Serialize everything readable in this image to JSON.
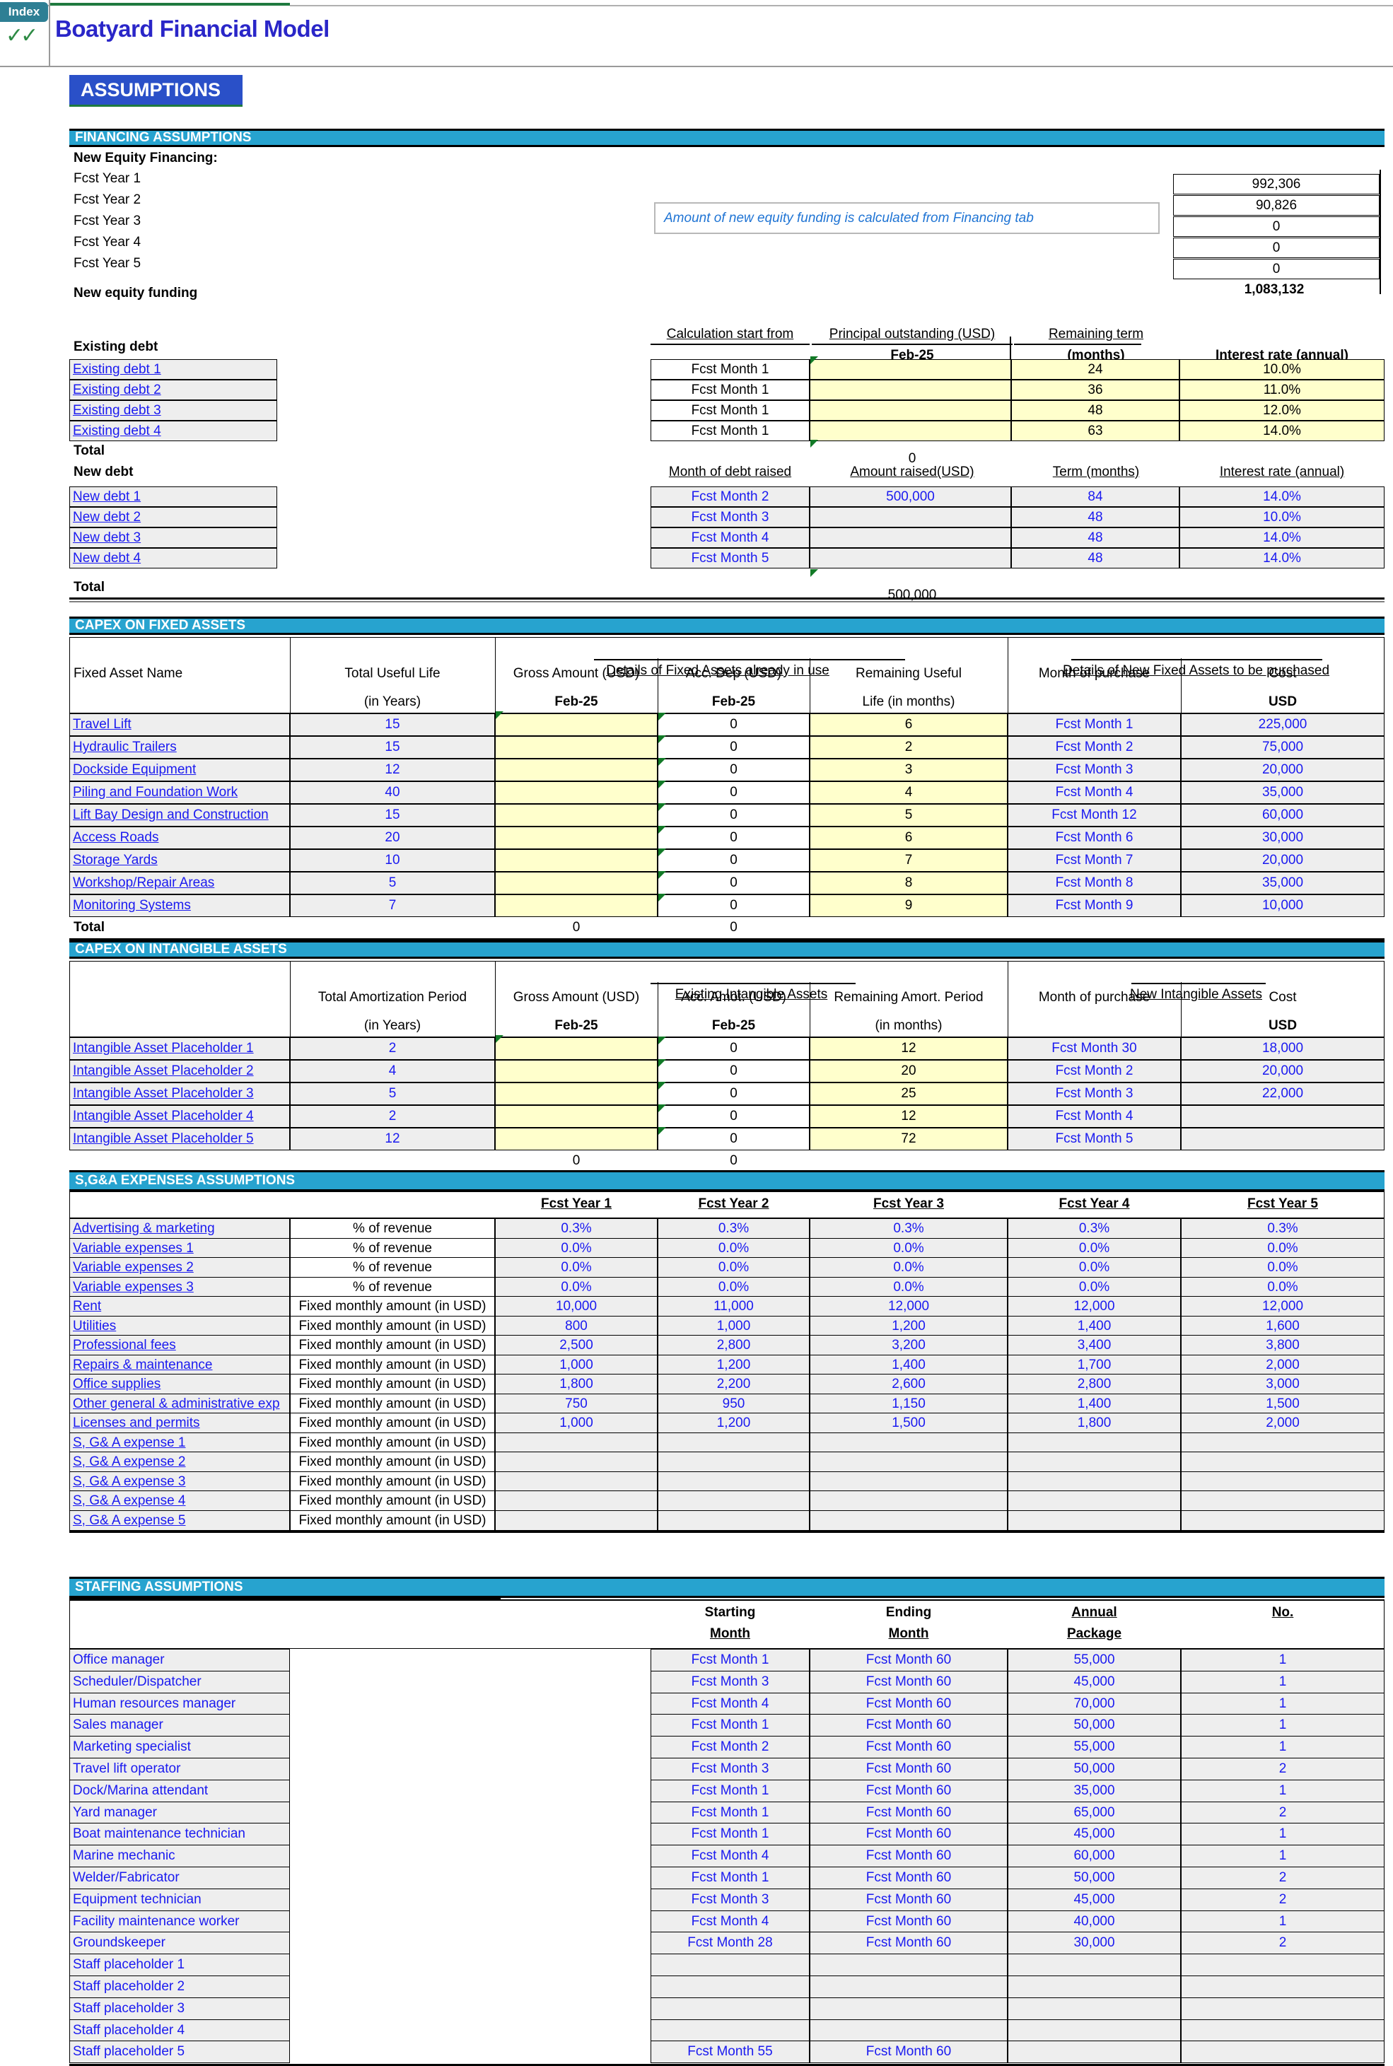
{
  "app": {
    "index_tab": "Index",
    "checks": "✓✓",
    "title": "Boatyard Financial Model",
    "page_banner": "ASSUMPTIONS"
  },
  "financing": {
    "banner": "FINANCING ASSUMPTIONS",
    "equity_heading": "New Equity Financing:",
    "equity_rows": [
      {
        "label": "Fcst Year 1",
        "value": "992,306"
      },
      {
        "label": "Fcst Year 2",
        "value": "90,826"
      },
      {
        "label": "Fcst Year 3",
        "value": "0"
      },
      {
        "label": "Fcst Year 4",
        "value": "0"
      },
      {
        "label": "Fcst Year 5",
        "value": "0"
      }
    ],
    "total_label": "New equity funding",
    "total_value": "1,083,132",
    "note": "Amount of new equity funding is calculated from Financing  tab",
    "existing_debt": {
      "section_label": "Existing debt",
      "headers_top": [
        "Calculation start from",
        "Principal outstanding (USD)",
        "Remaining term",
        ""
      ],
      "headers_bottom": [
        "",
        "Feb-25",
        "(months)",
        "Interest rate (annual)"
      ],
      "rows": [
        {
          "name": "Existing debt 1",
          "start": "Fcst Month 1",
          "principal": "",
          "term": "24",
          "rate": "10.0%"
        },
        {
          "name": "Existing debt 2",
          "start": "Fcst Month 1",
          "principal": "",
          "term": "36",
          "rate": "11.0%"
        },
        {
          "name": "Existing debt 3",
          "start": "Fcst Month 1",
          "principal": "",
          "term": "48",
          "rate": "12.0%"
        },
        {
          "name": "Existing debt 4",
          "start": "Fcst Month 1",
          "principal": "",
          "term": "63",
          "rate": "14.0%"
        }
      ],
      "total_label": "Total",
      "total_value": "0"
    },
    "new_debt": {
      "section_label": "New debt",
      "headers": [
        "Month of debt raised",
        "Amount raised(USD)",
        "Term (months)",
        "Interest rate (annual)"
      ],
      "rows": [
        {
          "name": "New debt 1",
          "month": "Fcst Month 2",
          "amount": "500,000",
          "term": "84",
          "rate": "14.0%"
        },
        {
          "name": "New debt 2",
          "month": "Fcst Month 3",
          "amount": "",
          "term": "48",
          "rate": "10.0%"
        },
        {
          "name": "New debt 3",
          "month": "Fcst Month 4",
          "amount": "",
          "term": "48",
          "rate": "14.0%"
        },
        {
          "name": "New debt 4",
          "month": "Fcst Month 5",
          "amount": "",
          "term": "48",
          "rate": "14.0%"
        }
      ],
      "total_label": "Total",
      "total_value": "500,000"
    }
  },
  "capex_fixed": {
    "banner": "CAPEX ON FIXED ASSETS",
    "group_existing": "Details of Fixed Assets already in use",
    "group_new": "Details of New Fixed Assets to be purchased",
    "headers": {
      "name": "Fixed Asset Name",
      "life1": "Total Useful Life",
      "life2": "(in Years)",
      "gross1": "Gross Amount (USD)",
      "gross2": "Feb-25",
      "accdep1": "Acc. Dep (USD)",
      "accdep2": "Feb-25",
      "remaining1": "Remaining Useful",
      "remaining2": "Life (in months)",
      "month": "Month of purchase",
      "cost1": "Cost",
      "cost2": "USD"
    },
    "rows": [
      {
        "name": "Travel Lift",
        "life": "15",
        "gross": "",
        "accdep": "0",
        "remaining": "6",
        "month": "Fcst Month 1",
        "cost": "225,000"
      },
      {
        "name": "Hydraulic Trailers",
        "life": "15",
        "gross": "",
        "accdep": "0",
        "remaining": "2",
        "month": "Fcst Month 2",
        "cost": "75,000"
      },
      {
        "name": "Dockside Equipment",
        "life": "12",
        "gross": "",
        "accdep": "0",
        "remaining": "3",
        "month": "Fcst Month 3",
        "cost": "20,000"
      },
      {
        "name": "Piling and Foundation Work",
        "life": "40",
        "gross": "",
        "accdep": "0",
        "remaining": "4",
        "month": "Fcst Month 4",
        "cost": "35,000"
      },
      {
        "name": "Lift Bay Design and Construction",
        "life": "15",
        "gross": "",
        "accdep": "0",
        "remaining": "5",
        "month": "Fcst Month 12",
        "cost": "60,000"
      },
      {
        "name": "Access Roads",
        "life": "20",
        "gross": "",
        "accdep": "0",
        "remaining": "6",
        "month": "Fcst Month 6",
        "cost": "30,000"
      },
      {
        "name": "Storage Yards",
        "life": "10",
        "gross": "",
        "accdep": "0",
        "remaining": "7",
        "month": "Fcst Month 7",
        "cost": "20,000"
      },
      {
        "name": "Workshop/Repair Areas",
        "life": "5",
        "gross": "",
        "accdep": "0",
        "remaining": "8",
        "month": "Fcst Month 8",
        "cost": "35,000"
      },
      {
        "name": "Monitoring Systems",
        "life": "7",
        "gross": "",
        "accdep": "0",
        "remaining": "9",
        "month": "Fcst Month 9",
        "cost": "10,000"
      }
    ],
    "total_label": "Total",
    "total_gross": "0",
    "total_accdep": "0"
  },
  "capex_intangible": {
    "banner": "CAPEX ON INTANGIBLE ASSETS",
    "group_existing": "Existing Intangible Assets",
    "group_new": "New Intangible Assets",
    "headers": {
      "period1": "Total Amortization Period",
      "period2": "(in Years)",
      "gross1": "Gross Amount (USD)",
      "gross2": "Feb-25",
      "accamot1": "Acc. Amot. (USD)",
      "accamot2": "Feb-25",
      "remaining1": "Remaining Amort. Period",
      "remaining2": "(in months)",
      "month": "Month of purchase",
      "cost1": "Cost",
      "cost2": "USD"
    },
    "rows": [
      {
        "name": "Intangible Asset Placeholder 1",
        "period": "2",
        "gross": "",
        "accamot": "0",
        "remaining": "12",
        "month": "Fcst Month 30",
        "cost": "18,000"
      },
      {
        "name": "Intangible Asset Placeholder 2",
        "period": "4",
        "gross": "",
        "accamot": "0",
        "remaining": "20",
        "month": "Fcst Month 2",
        "cost": "20,000"
      },
      {
        "name": "Intangible Asset Placeholder 3",
        "period": "5",
        "gross": "",
        "accamot": "0",
        "remaining": "25",
        "month": "Fcst Month 3",
        "cost": "22,000"
      },
      {
        "name": "Intangible Asset Placeholder 4",
        "period": "2",
        "gross": "",
        "accamot": "0",
        "remaining": "12",
        "month": "Fcst Month 4",
        "cost": ""
      },
      {
        "name": "Intangible Asset Placeholder 5",
        "period": "12",
        "gross": "",
        "accamot": "0",
        "remaining": "72",
        "month": "Fcst Month 5",
        "cost": ""
      }
    ],
    "total_gross": "0",
    "total_accamot": "0"
  },
  "sga": {
    "banner": "S,G&A EXPENSES ASSUMPTIONS",
    "year_headers": [
      "Fcst Year 1",
      "Fcst Year 2",
      "Fcst Year 3",
      "Fcst Year 4",
      "Fcst Year 5"
    ],
    "rows": [
      {
        "name": "Advertising & marketing",
        "basis": "% of revenue",
        "values": [
          "0.3%",
          "0.3%",
          "0.3%",
          "0.3%",
          "0.3%"
        ]
      },
      {
        "name": "Variable expenses 1",
        "basis": "% of revenue",
        "values": [
          "0.0%",
          "0.0%",
          "0.0%",
          "0.0%",
          "0.0%"
        ]
      },
      {
        "name": "Variable expenses 2",
        "basis": "% of revenue",
        "values": [
          "0.0%",
          "0.0%",
          "0.0%",
          "0.0%",
          "0.0%"
        ]
      },
      {
        "name": "Variable expenses 3",
        "basis": "% of revenue",
        "values": [
          "0.0%",
          "0.0%",
          "0.0%",
          "0.0%",
          "0.0%"
        ]
      },
      {
        "name": "Rent",
        "basis": "Fixed monthly amount (in USD)",
        "values": [
          "10,000",
          "11,000",
          "12,000",
          "12,000",
          "12,000"
        ]
      },
      {
        "name": "Utilities",
        "basis": "Fixed monthly amount (in USD)",
        "values": [
          "800",
          "1,000",
          "1,200",
          "1,400",
          "1,600"
        ]
      },
      {
        "name": "Professional fees",
        "basis": "Fixed monthly amount (in USD)",
        "values": [
          "2,500",
          "2,800",
          "3,200",
          "3,400",
          "3,800"
        ]
      },
      {
        "name": "Repairs & maintenance",
        "basis": "Fixed monthly amount (in USD)",
        "values": [
          "1,000",
          "1,200",
          "1,400",
          "1,700",
          "2,000"
        ]
      },
      {
        "name": "Office supplies",
        "basis": "Fixed monthly amount (in USD)",
        "values": [
          "1,800",
          "2,200",
          "2,600",
          "2,800",
          "3,000"
        ]
      },
      {
        "name": "Other general & administrative exp",
        "basis": "Fixed monthly amount (in USD)",
        "values": [
          "750",
          "950",
          "1,150",
          "1,400",
          "1,500"
        ]
      },
      {
        "name": "Licenses and permits",
        "basis": "Fixed monthly amount (in USD)",
        "values": [
          "1,000",
          "1,200",
          "1,500",
          "1,800",
          "2,000"
        ]
      },
      {
        "name": "S, G& A expense 1",
        "basis": "Fixed monthly amount (in USD)",
        "values": [
          "",
          "",
          "",
          "",
          ""
        ]
      },
      {
        "name": "S, G& A expense 2",
        "basis": "Fixed monthly amount (in USD)",
        "values": [
          "",
          "",
          "",
          "",
          ""
        ]
      },
      {
        "name": "S, G& A expense 3",
        "basis": "Fixed monthly amount (in USD)",
        "values": [
          "",
          "",
          "",
          "",
          ""
        ]
      },
      {
        "name": "S, G& A expense 4",
        "basis": "Fixed monthly amount (in USD)",
        "values": [
          "",
          "",
          "",
          "",
          ""
        ]
      },
      {
        "name": "S, G& A expense 5",
        "basis": "Fixed monthly amount (in USD)",
        "values": [
          "",
          "",
          "",
          "",
          ""
        ]
      }
    ]
  },
  "staffing": {
    "banner": "STAFFING ASSUMPTIONS",
    "headers": {
      "start1": "Starting",
      "start2": "Month",
      "end1": "Ending",
      "end2": "Month",
      "pkg1": "Annual",
      "pkg2": "Package",
      "no": "No."
    },
    "rows": [
      {
        "name": "Office manager",
        "start": "Fcst Month 1",
        "end": "Fcst Month 60",
        "package": "55,000",
        "no": "1"
      },
      {
        "name": "Scheduler/Dispatcher",
        "start": "Fcst Month 3",
        "end": "Fcst Month 60",
        "package": "45,000",
        "no": "1"
      },
      {
        "name": "Human resources manager",
        "start": "Fcst Month 4",
        "end": "Fcst Month 60",
        "package": "70,000",
        "no": "1"
      },
      {
        "name": "Sales manager",
        "start": "Fcst Month 1",
        "end": "Fcst Month 60",
        "package": "50,000",
        "no": "1"
      },
      {
        "name": "Marketing specialist",
        "start": "Fcst Month 2",
        "end": "Fcst Month 60",
        "package": "55,000",
        "no": "1"
      },
      {
        "name": "Travel lift operator",
        "start": "Fcst Month 3",
        "end": "Fcst Month 60",
        "package": "50,000",
        "no": "2"
      },
      {
        "name": "Dock/Marina attendant",
        "start": "Fcst Month 1",
        "end": "Fcst Month 60",
        "package": "35,000",
        "no": "1"
      },
      {
        "name": "Yard manager",
        "start": "Fcst Month 1",
        "end": "Fcst Month 60",
        "package": "65,000",
        "no": "2"
      },
      {
        "name": "Boat maintenance technician",
        "start": "Fcst Month 1",
        "end": "Fcst Month 60",
        "package": "45,000",
        "no": "1"
      },
      {
        "name": "Marine mechanic",
        "start": "Fcst Month 4",
        "end": "Fcst Month 60",
        "package": "60,000",
        "no": "1"
      },
      {
        "name": "Welder/Fabricator",
        "start": "Fcst Month 1",
        "end": "Fcst Month 60",
        "package": "50,000",
        "no": "2"
      },
      {
        "name": "Equipment technician",
        "start": "Fcst Month 3",
        "end": "Fcst Month 60",
        "package": "45,000",
        "no": "2"
      },
      {
        "name": "Facility maintenance worker",
        "start": "Fcst Month 4",
        "end": "Fcst Month 60",
        "package": "40,000",
        "no": "1"
      },
      {
        "name": "Groundskeeper",
        "start": "Fcst Month 28",
        "end": "Fcst Month 60",
        "package": "30,000",
        "no": "2"
      },
      {
        "name": "Staff placeholder 1",
        "start": "",
        "end": "",
        "package": "",
        "no": ""
      },
      {
        "name": "Staff placeholder 2",
        "start": "",
        "end": "",
        "package": "",
        "no": ""
      },
      {
        "name": "Staff placeholder 3",
        "start": "",
        "end": "",
        "package": "",
        "no": ""
      },
      {
        "name": "Staff placeholder 4",
        "start": "",
        "end": "",
        "package": "",
        "no": ""
      },
      {
        "name": "Staff placeholder 5",
        "start": "Fcst Month 55",
        "end": "Fcst Month 60",
        "package": "",
        "no": ""
      }
    ]
  },
  "colors": {
    "banner": "#27a3cf",
    "assumptions": "#2a50c8",
    "title": "#2a26c8",
    "blue_text": "#1a1af0",
    "input_yellow": "#ffffcc",
    "grey_cell": "#eeeeee",
    "index_tab": "#2e7f94"
  }
}
